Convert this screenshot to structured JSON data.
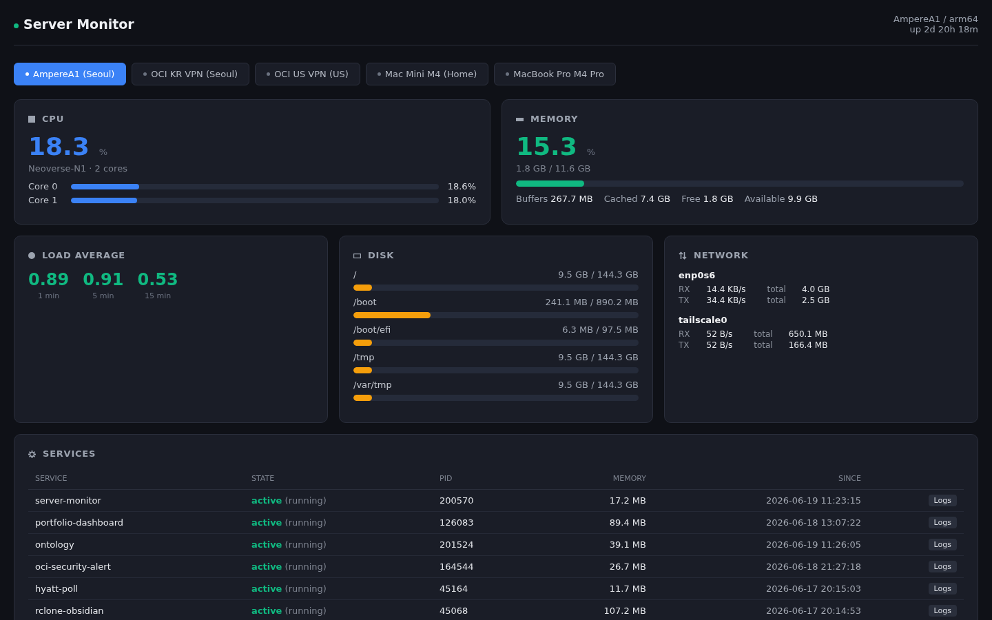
{
  "header": {
    "title": "Server Monitor",
    "online": true,
    "host": "AmpereA1 / arm64",
    "uptime": "up 2d 20h 18m"
  },
  "tabs": [
    {
      "label": "AmpereA1 (Seoul)",
      "selected": true
    },
    {
      "label": "OCI KR VPN (Seoul)",
      "selected": false
    },
    {
      "label": "OCI US VPN (US)",
      "selected": false
    },
    {
      "label": "Mac Mini M4 (Home)",
      "selected": false
    },
    {
      "label": "MacBook Pro M4 Pro",
      "selected": false
    }
  ],
  "cpu": {
    "title": "CPU",
    "value": "18.3",
    "unit": "%",
    "model": "Neoverse-N1 · 2 cores",
    "cores": [
      {
        "name": "Core 0",
        "level": 0.186,
        "reading": "18.6%"
      },
      {
        "name": "Core 1",
        "level": 0.18,
        "reading": "18.0%"
      }
    ]
  },
  "memory": {
    "title": "MEMORY",
    "value": "15.3",
    "unit": "%",
    "usage": "1.8 GB / 11.6 GB",
    "level": 0.153,
    "stats": [
      {
        "label": "Buffers",
        "value": "267.7 MB"
      },
      {
        "label": "Cached",
        "value": "7.4 GB"
      },
      {
        "label": "Free",
        "value": "1.8 GB"
      },
      {
        "label": "Available",
        "value": "9.9 GB"
      }
    ]
  },
  "load_average": {
    "title": "LOAD AVERAGE",
    "values": [
      {
        "value": "0.89",
        "label": "1 min"
      },
      {
        "value": "0.91",
        "label": "5 min"
      },
      {
        "value": "0.53",
        "label": "15 min"
      }
    ]
  },
  "disk": {
    "title": "DISK",
    "mounts": [
      {
        "mount": "/",
        "usage": "9.5 GB / 144.3 GB",
        "level": 0.066
      },
      {
        "mount": "/boot",
        "usage": "241.1 MB / 890.2 MB",
        "level": 0.271
      },
      {
        "mount": "/boot/efi",
        "usage": "6.3 MB / 97.5 MB",
        "level": 0.065
      },
      {
        "mount": "/tmp",
        "usage": "9.5 GB / 144.3 GB",
        "level": 0.066
      },
      {
        "mount": "/var/tmp",
        "usage": "9.5 GB / 144.3 GB",
        "level": 0.066
      }
    ]
  },
  "network": {
    "title": "NETWORK",
    "interfaces": [
      {
        "name": "enp0s6",
        "rows": [
          {
            "direction": "RX",
            "rate": "14.4 KB/s",
            "total_label": "total",
            "total": "4.0 GB"
          },
          {
            "direction": "TX",
            "rate": "34.4 KB/s",
            "total_label": "total",
            "total": "2.5 GB"
          }
        ]
      },
      {
        "name": "tailscale0",
        "rows": [
          {
            "direction": "RX",
            "rate": "52 B/s",
            "total_label": "total",
            "total": "650.1 MB"
          },
          {
            "direction": "TX",
            "rate": "52 B/s",
            "total_label": "total",
            "total": "166.4 MB"
          }
        ]
      }
    ]
  },
  "services": {
    "title": "SERVICES",
    "columns": [
      "SERVICE",
      "STATE",
      "PID",
      "MEMORY",
      "SINCE"
    ],
    "rows": [
      {
        "name": "server-monitor",
        "state": "active",
        "sub_state": "(running)",
        "pid": "200570",
        "memory": "17.2 MB",
        "since": "2026-06-19 11:23:15",
        "action": "Logs"
      },
      {
        "name": "portfolio-dashboard",
        "state": "active",
        "sub_state": "(running)",
        "pid": "126083",
        "memory": "89.4 MB",
        "since": "2026-06-18 13:07:22",
        "action": "Logs"
      },
      {
        "name": "ontology",
        "state": "active",
        "sub_state": "(running)",
        "pid": "201524",
        "memory": "39.1 MB",
        "since": "2026-06-19 11:26:05",
        "action": "Logs"
      },
      {
        "name": "oci-security-alert",
        "state": "active",
        "sub_state": "(running)",
        "pid": "164544",
        "memory": "26.7 MB",
        "since": "2026-06-18 21:27:18",
        "action": "Logs"
      },
      {
        "name": "hyatt-poll",
        "state": "active",
        "sub_state": "(running)",
        "pid": "45164",
        "memory": "11.7 MB",
        "since": "2026-06-17 20:15:03",
        "action": "Logs"
      },
      {
        "name": "rclone-obsidian",
        "state": "active",
        "sub_state": "(running)",
        "pid": "45068",
        "memory": "107.2 MB",
        "since": "2026-06-17 20:14:53",
        "action": "Logs"
      }
    ]
  }
}
